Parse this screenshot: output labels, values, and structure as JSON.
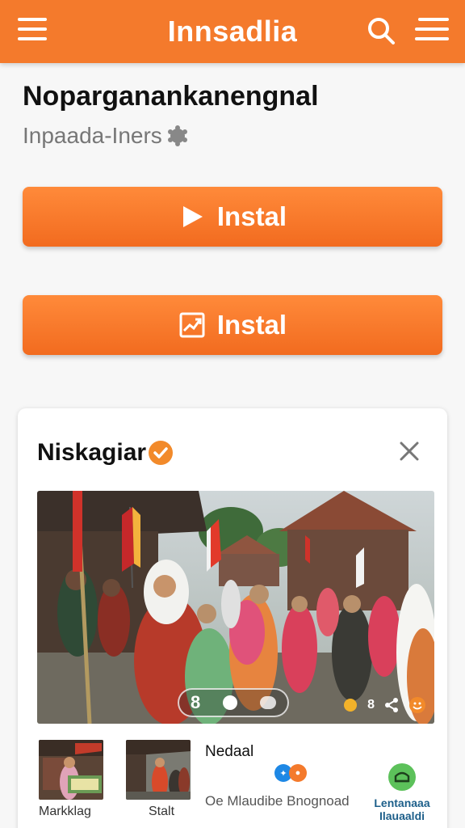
{
  "header": {
    "title": "Innsadlia",
    "menu_icon": "hamburger-menu-icon",
    "search_icon": "search-icon",
    "list_icon": "list-icon",
    "color": "#f47a2c"
  },
  "page": {
    "heading": "Noparganankanengnal",
    "subtitle": "Inpaada-Iners",
    "subtitle_icon": "gear-icon"
  },
  "buttons": [
    {
      "label": "Instal",
      "icon": "play-icon"
    },
    {
      "label": "Instal",
      "icon": "chart-icon"
    }
  ],
  "card": {
    "title": "Niskagiar",
    "badge_icon": "verified-badge-icon",
    "close_icon": "close-icon",
    "carousel": {
      "number": "8"
    },
    "photo_tools": {
      "count": "8"
    },
    "thumbnails": [
      {
        "label": "Markklag"
      },
      {
        "label": "Stalt"
      }
    ],
    "detail": {
      "title": "Nedaal",
      "subtitle": "Oe Mlaudibe Bnognoad"
    },
    "action": {
      "label_line1": "Lentanaaa",
      "label_line2": "Ilauaaldi",
      "icon": "cloud-upload-icon"
    }
  }
}
